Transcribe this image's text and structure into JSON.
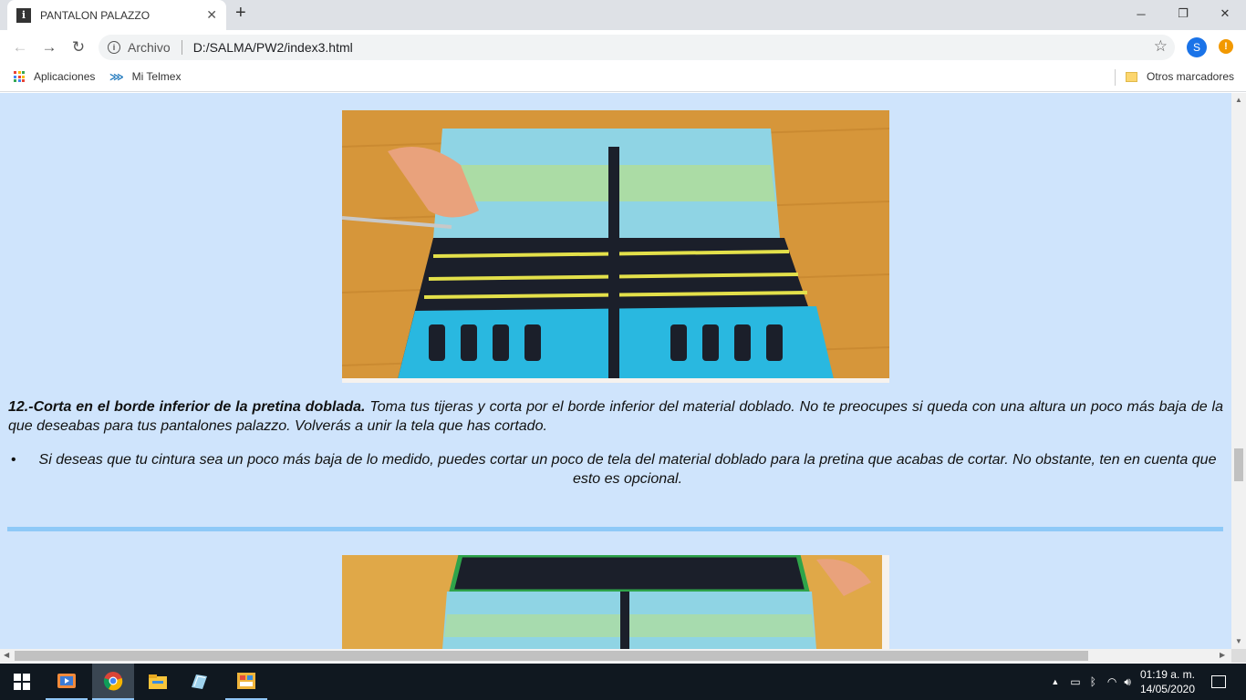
{
  "browser": {
    "tab_title": "PANTALON PALAZZO",
    "tab_favicon": "i",
    "new_tab": "+",
    "close": "✕",
    "url_label": "Archivo",
    "url": "D:/SALMA/PW2/index3.html",
    "profile_initial": "S",
    "update_badge": "!"
  },
  "bookmarks": {
    "apps": "Aplicaciones",
    "telmex": "Mi Telmex",
    "other": "Otros marcadores"
  },
  "content": {
    "step_title": "12.-Corta en el borde inferior de la pretina doblada.",
    "step_text": " Toma tus tijeras y corta por el borde inferior del material doblado. No te preocupes si queda con una altura un poco más baja de la que deseabas para tus pantalones palazzo. Volverás a unir la tela que has cortado.",
    "bullet": "Si deseas que tu cintura sea un poco más baja de lo medido, puedes cortar un poco de tela del material doblado para la pretina que acabas de cortar. No obstante, ten en cuenta que esto es opcional."
  },
  "taskbar": {
    "time": "01:19 a. m.",
    "date": "14/05/2020"
  },
  "colors": {
    "page_bg": "#cfe4fc",
    "hr": "#8ec9f7",
    "taskbar": "#101820"
  }
}
